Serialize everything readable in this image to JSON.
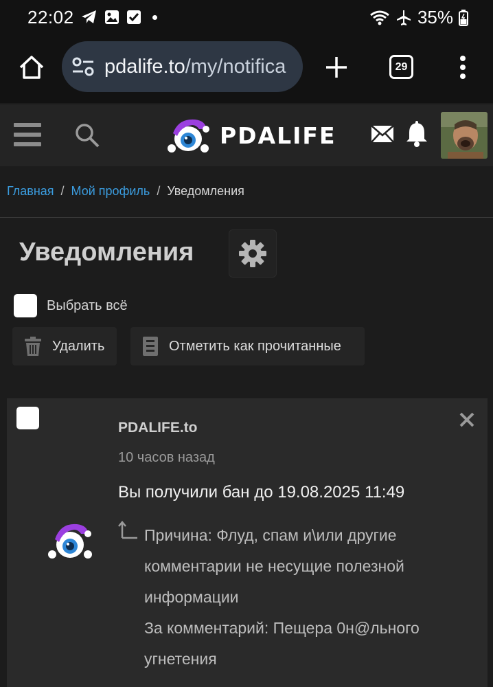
{
  "status_bar": {
    "time": "22:02",
    "battery": "35%"
  },
  "browser": {
    "url_host": "pdalife.to",
    "url_path": "/my/notifica",
    "tab_count": "29"
  },
  "site": {
    "logo_text": "PDALIFE"
  },
  "breadcrumb": {
    "home": "Главная",
    "profile": "Мой профиль",
    "current": "Уведомления"
  },
  "page": {
    "title": "Уведомления",
    "select_all": "Выбрать всё",
    "delete_label": "Удалить",
    "mark_read_label": "Отметить как прочитанные"
  },
  "notification": {
    "author": "PDALIFE.to",
    "time": "10 часов назад",
    "title": "Вы получили бан до 19.08.2025 11:49",
    "reason": "Причина: Флуд, спам и\\или другие комментарии не несущие полезной информации",
    "comment": "За комментарий: Пещера 0н@льного угнетения"
  },
  "colors": {
    "accent_link": "#3b9de0",
    "brand_purple": "#9b3fe0",
    "brand_blue": "#2d86d6"
  }
}
